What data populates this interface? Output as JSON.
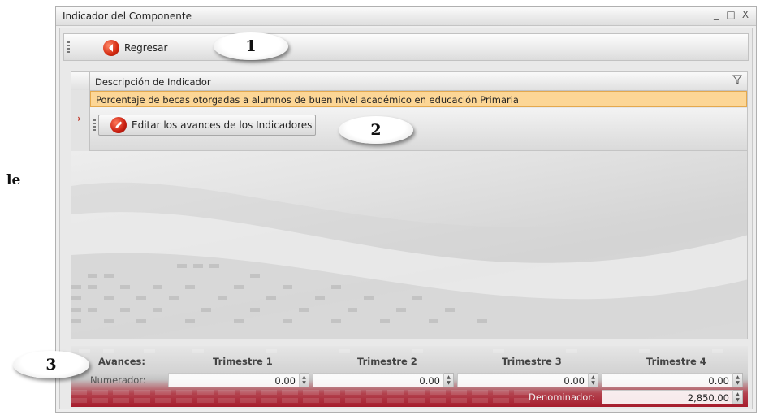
{
  "side_text": "le",
  "window": {
    "title": "Indicador del Componente",
    "controls": [
      "_",
      "□",
      "X"
    ]
  },
  "toolbar": {
    "back_label": "Regresar",
    "back_icon": "back-arrow-icon"
  },
  "callouts": [
    "1",
    "2",
    "3"
  ],
  "grid": {
    "column_header": "Descripción de Indicador",
    "filter_icon": "filter-icon",
    "row_text": "Porcentaje de becas otorgadas a alumnos de buen nivel académico en educación Primaria",
    "edit_button_label": "Editar los avances de los Indicadores",
    "edit_icon": "edit-icon"
  },
  "avances": {
    "title": "Avances:",
    "quarters": [
      "Trimestre 1",
      "Trimestre 2",
      "Trimestre 3",
      "Trimestre 4"
    ],
    "numerador_label": "Numerador:",
    "numerador_values": [
      "0.00",
      "0.00",
      "0.00",
      "0.00"
    ],
    "denominador_label": "Denominador:",
    "denominador_value": "2,850.00"
  },
  "colors": {
    "row_highlight": "#fcd696",
    "accent_red": "#c81e10",
    "footer_red": "#a61c2c"
  }
}
